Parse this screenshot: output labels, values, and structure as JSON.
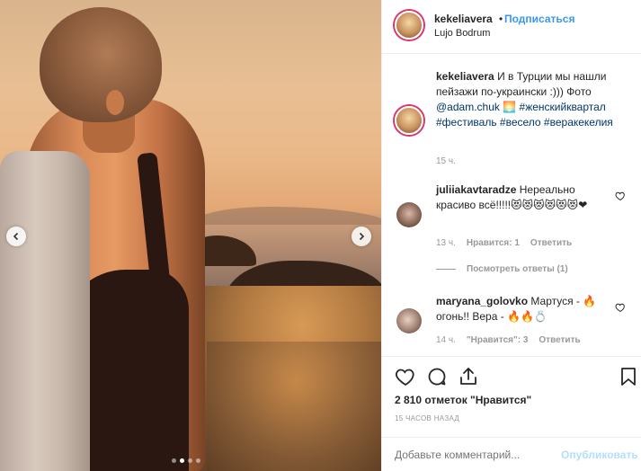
{
  "post": {
    "photo_description": "",
    "carousel": {
      "slides": 4,
      "active": 1
    }
  },
  "header": {
    "username": "kekeliavera",
    "separator": "•",
    "follow_label": "Подписаться",
    "location": "Lujo Bodrum"
  },
  "caption": {
    "username": "kekeliavera",
    "text": "И в Турции мы нашли пейзажи по-украински :))) Фото",
    "mention": "@adam.chuk",
    "emoji": "🌅",
    "hashtags": "#женскийквартал #фестиваль #весело #веракекелия",
    "time": "15 ч."
  },
  "comments": [
    {
      "username": "juliiakavtaradze",
      "text": "Нереально красиво всё!!!!!😻😻😻😻😻😻❤",
      "time": "13 ч.",
      "likes": "Нравится: 1",
      "reply": "Ответить",
      "view_replies": "Посмотреть ответы (1)"
    },
    {
      "username": "maryana_golovko",
      "text": "Мартуся - 🔥 огонь!! Вера - 🔥🔥💍",
      "time": "14 ч.",
      "likes": "\"Нравится\": 3",
      "reply": "Ответить"
    }
  ],
  "actions": {
    "likes_text": "2 810 отметок \"Нравится\"",
    "posted_ago": "15 ЧАСОВ НАЗАД"
  },
  "add_comment": {
    "placeholder": "Добавьте комментарий...",
    "publish_label": "Опубликовать"
  },
  "colors": {
    "link": "#3897f0",
    "story_ring": "#e1306c",
    "muted": "#999999",
    "publish_disabled": "#b2dffc"
  }
}
